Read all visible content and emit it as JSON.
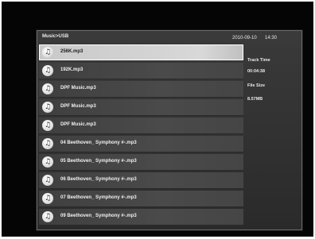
{
  "header": {
    "breadcrumb": "Music>USB",
    "date": "2010-09-10",
    "time": "14:30"
  },
  "files": [
    {
      "name": "256K.mp3",
      "selected": true
    },
    {
      "name": "192K.mp3"
    },
    {
      "name": "DPF Music.mp3"
    },
    {
      "name": "DPF Music.mp3"
    },
    {
      "name": "DPF Music.mp3"
    },
    {
      "name": "04 Beethoven_ Symphony #-.mp3"
    },
    {
      "name": "05 Beethoven_ Symphony #-.mp3"
    },
    {
      "name": "06 Beethoven_ Symphony #-.mp3"
    },
    {
      "name": "07 Beethoven_ Symphony #-.mp3"
    },
    {
      "name": "09 Beethoven_ Symphony #-.mp3"
    }
  ],
  "info": {
    "track_time_label": "Track Time",
    "track_time": "00:04:38",
    "file_size_label": "File Size",
    "file_size": "8.57MB"
  },
  "icons": {
    "file": "music-note-icon",
    "glyph": "♫"
  }
}
